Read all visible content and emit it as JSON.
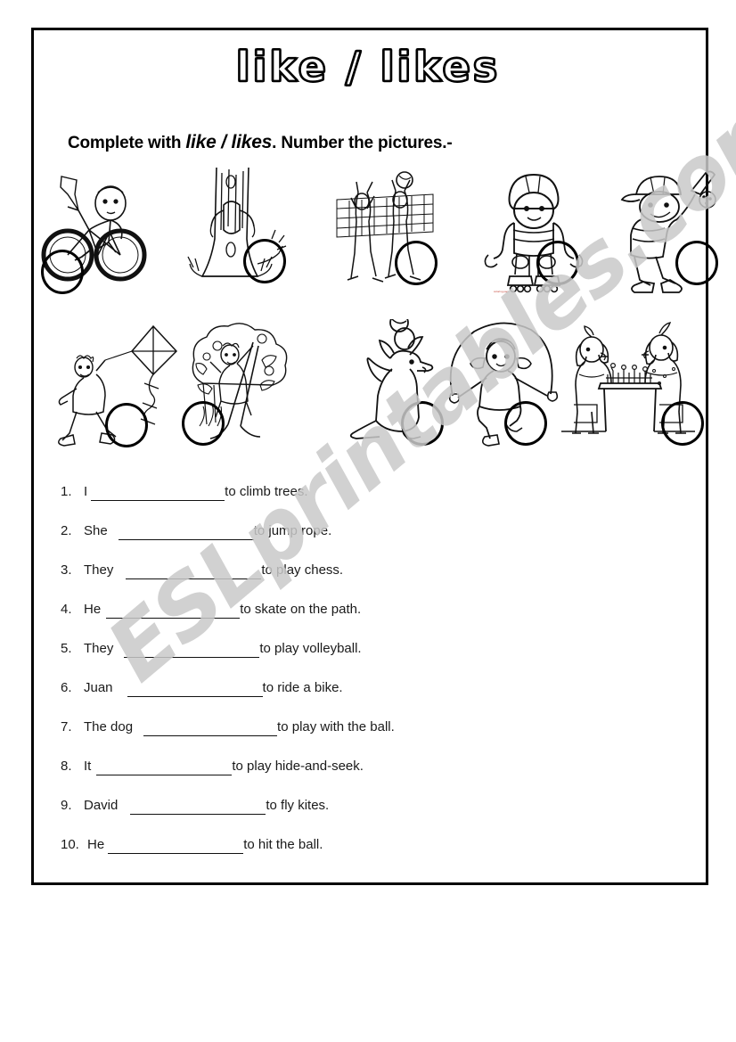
{
  "page": {
    "title": "like / likes",
    "instruction": {
      "lead": "Complete with ",
      "emphasis": "like / likes",
      "tail": ". Number the pictures.-"
    },
    "watermark": "ESLprintables.com",
    "border_color": "#000000",
    "background_color": "#ffffff",
    "watermark_color": "#c9c9c9"
  },
  "pictures": {
    "row1": [
      {
        "name": "boy-riding-bike",
        "caption": "boy riding a bicycle with a flag",
        "circle": "empty"
      },
      {
        "name": "child-climbing-tree",
        "caption": "child climbing a tree trunk",
        "circle": "empty"
      },
      {
        "name": "volleyball-players",
        "caption": "players jumping at a volleyball net",
        "circle": "empty"
      },
      {
        "name": "child-rollerblading",
        "caption": "child on inline skates with helmet",
        "circle": "empty",
        "tiny_caption": "coloring page"
      },
      {
        "name": "boy-batting-ball",
        "caption": "boy with a bat hitting a ball",
        "circle": "empty"
      }
    ],
    "row2": [
      {
        "name": "boy-flying-kite",
        "caption": "boy running while flying a kite",
        "circle": "empty"
      },
      {
        "name": "child-hiding-in-tree",
        "caption": "child hiding up in a leafy tree",
        "circle": "empty"
      },
      {
        "name": "dog-with-ball",
        "caption": "dog balancing a ball on its nose",
        "circle": "empty"
      },
      {
        "name": "girl-jumping-rope",
        "caption": "girl skipping with a jump rope",
        "circle": "empty"
      },
      {
        "name": "dogs-playing-chess",
        "caption": "two dogs playing chess at a table",
        "circle": "empty"
      }
    ]
  },
  "sentences": [
    {
      "num": "1.",
      "subject": "I",
      "blank": "________________",
      "tail": "to climb trees."
    },
    {
      "num": "2.",
      "subject": "She",
      "blank": "________________",
      "tail": "to jump rope."
    },
    {
      "num": "3.",
      "subject": "They",
      "blank": "________________",
      "tail": "to play chess."
    },
    {
      "num": "4.",
      "subject": "He",
      "blank": "________________",
      "tail": "to skate on the path."
    },
    {
      "num": "5.",
      "subject": "They",
      "blank": "________________",
      "tail": "to play volleyball."
    },
    {
      "num": "6.",
      "subject": "Juan",
      "blank": "________________",
      "tail": "to ride a bike."
    },
    {
      "num": "7.",
      "subject": "The dog",
      "blank": "________________",
      "tail": "to play with the ball."
    },
    {
      "num": "8.",
      "subject": "It",
      "blank": "________________",
      "tail": "to play hide-and-seek."
    },
    {
      "num": "9.",
      "subject": "David",
      "blank": "________________",
      "tail": "to fly kites."
    },
    {
      "num": "10.",
      "subject": "He",
      "blank": "________________",
      "tail": "to hit the ball."
    }
  ]
}
